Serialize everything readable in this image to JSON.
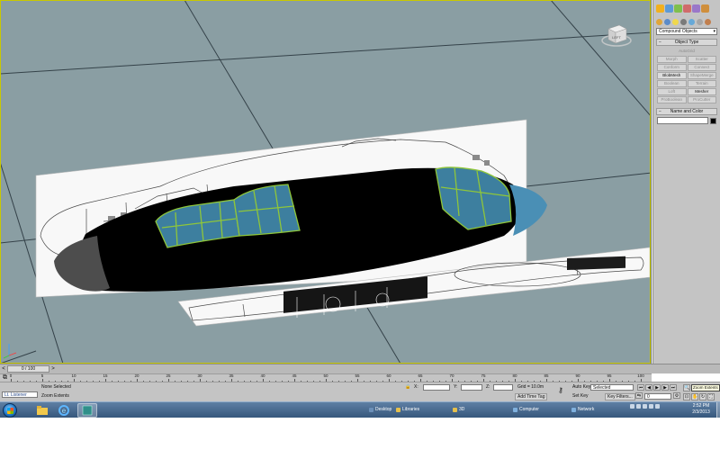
{
  "viewport": {
    "grid_color": "#26323a",
    "background": "#8a9ea3",
    "viewcube_label": "LEFT"
  },
  "command_panel": {
    "category_dropdown": "Compound Objects",
    "object_type": {
      "header": "Object Type",
      "autogrid": "AutoGrid",
      "buttons": [
        {
          "label": "Morph",
          "enabled": false
        },
        {
          "label": "Scatter",
          "enabled": false
        },
        {
          "label": "Conform",
          "enabled": false
        },
        {
          "label": "Connect",
          "enabled": false
        },
        {
          "label": "BlobMesh",
          "enabled": true
        },
        {
          "label": "ShapeMerge",
          "enabled": false
        },
        {
          "label": "Boolean",
          "enabled": false
        },
        {
          "label": "Terrain",
          "enabled": false
        },
        {
          "label": "Loft",
          "enabled": false
        },
        {
          "label": "Mesher",
          "enabled": true
        },
        {
          "label": "ProBoolean",
          "enabled": false
        },
        {
          "label": "ProCutter",
          "enabled": false
        }
      ]
    },
    "name_and_color": {
      "header": "Name and Color",
      "name_value": "",
      "color": "#000000"
    }
  },
  "time_slider": {
    "label": "0 / 100",
    "prev_glyph": "<",
    "next_glyph": ">"
  },
  "trackbar": {
    "labels": [
      "0",
      "5",
      "10",
      "15",
      "20",
      "25",
      "30",
      "35",
      "40",
      "45",
      "50",
      "55",
      "60",
      "65",
      "70",
      "75",
      "80",
      "85",
      "90",
      "95",
      "100"
    ]
  },
  "status": {
    "listener": "Lt. Listener",
    "selection": "None Selected",
    "prompt": "Zoom Extents",
    "x_label": "X:",
    "y_label": "Y:",
    "z_label": "Z:",
    "x_value": "",
    "y_value": "",
    "z_value": "",
    "grid": "Grid = 10.0m",
    "add_time_tag": "Add Time Tag",
    "auto_key": "Auto Key",
    "auto_key_mode": "Selected",
    "set_key": "Set Key",
    "key_filters": "Key Filters...",
    "frame_value": "0",
    "tooltip": "Zoom Extents"
  },
  "taskbar": {
    "items": [
      {
        "label": "Desktop",
        "color": "#6b8fb8"
      },
      {
        "label": "Libraries",
        "color": "#e5c04d"
      },
      {
        "label": "3D",
        "color": "#e5c04d"
      },
      {
        "label": "Computer",
        "color": "#7fb0de"
      },
      {
        "label": "Network",
        "color": "#7fb0de"
      }
    ],
    "time": "2:52 PM",
    "date": "2/3/2013"
  },
  "colors": {
    "canopy": "#3d7f9f",
    "canopy_frame": "#8fc63a",
    "nose": "#4d4d4d",
    "body": "#000000",
    "spinner": "#4a8fb5"
  }
}
